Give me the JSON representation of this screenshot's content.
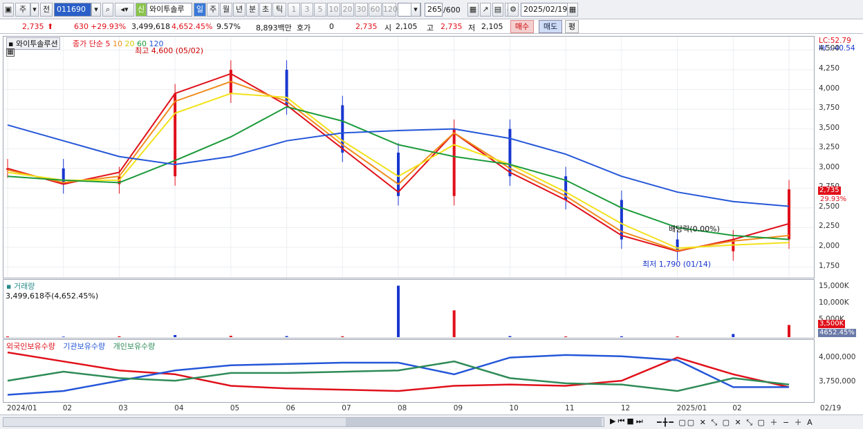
{
  "toolbar": {
    "market": "주",
    "compare": "전",
    "code": "011690",
    "name": "와이투솔루",
    "badge": "신",
    "periods": [
      "일",
      "주",
      "월",
      "년",
      "분",
      "초",
      "틱"
    ],
    "minutes": [
      "1",
      "3",
      "5",
      "10",
      "20",
      "30",
      "60",
      "120"
    ],
    "count": "265",
    "count_max": "/600",
    "date": "2025/02/19"
  },
  "quote": {
    "price": "2,735",
    "change": "630",
    "change_pct": "+29.93%",
    "volume": "3,499,618",
    "volume_pct": "4,652.45%",
    "turnover": "9.57%",
    "amount": "8,893백만",
    "hoga_label": "호가",
    "hoga_value": "0",
    "hoga_price": "2,735",
    "open_label": "시",
    "open": "2,105",
    "high_label": "고",
    "high": "2,735",
    "low_label": "저",
    "low": "2,105",
    "buy": "매수",
    "sell": "매도",
    "flat": "평"
  },
  "price_panel": {
    "title": "와이투솔루션",
    "ma_label": "종가 단순",
    "ma_periods": [
      "5",
      "10",
      "20",
      "60",
      "120"
    ],
    "ma_colors": [
      "#e0101a",
      "#f08c1c",
      "#f2e21a",
      "#1b9a3a",
      "#2456d8"
    ],
    "lc": "LC:52.79",
    "hc": "HC:-40.54",
    "high_note": "최고 4,600 (05/02)",
    "low_note": "최저 1,790 (01/14)",
    "div_note": "배당락(0.00%)",
    "last_price": "2,735",
    "last_pct": "29.93%"
  },
  "volume_panel": {
    "title": "거래량",
    "summary": "3,499,618주(4,652.45%)",
    "last": "3,500K",
    "last_pct": "4652.45%",
    "ticks": [
      "15,000K",
      "10,000K",
      "5,000K"
    ]
  },
  "holding_panel": {
    "legend": [
      "외국인보유수량",
      "기관보유수량",
      "개인보유수량"
    ],
    "ticks": [
      "4,000,000",
      "3,750,000"
    ],
    "colors": [
      "#e0101a",
      "#2456d8",
      "#2e8b57"
    ]
  },
  "x_ticks": [
    "2024/01",
    "02",
    "03",
    "04",
    "05",
    "06",
    "07",
    "08",
    "09",
    "10",
    "11",
    "12",
    "2025/01",
    "02",
    "02/19"
  ],
  "chart_data": [
    {
      "type": "candlestick",
      "title": "와이투솔루션",
      "ylim": [
        1650,
        4600
      ],
      "yticks": [
        4500,
        4250,
        4000,
        3750,
        3500,
        3250,
        3000,
        2750,
        2500,
        2250,
        2000,
        1750
      ],
      "x": [
        "2024/01",
        "02",
        "03",
        "04",
        "05",
        "06",
        "07",
        "08",
        "09",
        "10",
        "11",
        "12",
        "2025/01",
        "02",
        "02/19"
      ],
      "close_approx": [
        3000,
        2800,
        2900,
        3950,
        4250,
        3800,
        3200,
        2650,
        3500,
        2900,
        2600,
        2100,
        1950,
        2100,
        2735
      ],
      "series": [
        {
          "name": "5",
          "values": [
            3000,
            2800,
            2950,
            3950,
            4200,
            3800,
            3250,
            2700,
            3450,
            2950,
            2600,
            2150,
            1950,
            2100,
            2300
          ]
        },
        {
          "name": "10",
          "values": [
            2980,
            2820,
            2900,
            3850,
            4100,
            3850,
            3300,
            2800,
            3450,
            3000,
            2650,
            2200,
            1960,
            2080,
            2150
          ]
        },
        {
          "name": "20",
          "values": [
            2950,
            2850,
            2850,
            3700,
            3950,
            3900,
            3350,
            2900,
            3300,
            3050,
            2700,
            2300,
            1990,
            2030,
            2060
          ]
        },
        {
          "name": "60",
          "values": [
            2900,
            2850,
            2820,
            3100,
            3400,
            3780,
            3600,
            3300,
            3150,
            3050,
            2850,
            2500,
            2250,
            2150,
            2100
          ]
        },
        {
          "name": "120",
          "values": [
            3550,
            3350,
            3150,
            3050,
            3150,
            3350,
            3450,
            3480,
            3500,
            3380,
            3180,
            2900,
            2700,
            2580,
            2520
          ]
        }
      ]
    },
    {
      "type": "bar",
      "title": "거래량",
      "ylim": [
        0,
        15500
      ],
      "x": [
        "2024/01",
        "02",
        "03",
        "04",
        "05",
        "06",
        "07",
        "08",
        "09",
        "10",
        "11",
        "12",
        "2025/01",
        "02",
        "02/19"
      ],
      "values": [
        200,
        150,
        250,
        600,
        400,
        300,
        250,
        14800,
        7700,
        300,
        200,
        250,
        200,
        900,
        3500
      ]
    },
    {
      "type": "line",
      "title": "보유수량",
      "ylim": [
        3650000,
        4080000
      ],
      "x": [
        "2024/01",
        "02",
        "03",
        "04",
        "05",
        "06",
        "07",
        "08",
        "09",
        "10",
        "11",
        "12",
        "2025/01",
        "02",
        "02/19"
      ],
      "series": [
        {
          "name": "외국인보유수량",
          "values": [
            4020000,
            3950000,
            3880000,
            3850000,
            3760000,
            3740000,
            3730000,
            3720000,
            3760000,
            3770000,
            3760000,
            3800000,
            3980000,
            3850000,
            3750000
          ]
        },
        {
          "name": "기관보유수량",
          "values": [
            3690000,
            3720000,
            3800000,
            3880000,
            3920000,
            3930000,
            3940000,
            3940000,
            3850000,
            3980000,
            4000000,
            3990000,
            3960000,
            3750000,
            3750000
          ]
        },
        {
          "name": "개인보유수량",
          "values": [
            3800000,
            3870000,
            3820000,
            3800000,
            3860000,
            3860000,
            3870000,
            3880000,
            3950000,
            3820000,
            3780000,
            3770000,
            3720000,
            3820000,
            3770000
          ]
        }
      ]
    }
  ]
}
